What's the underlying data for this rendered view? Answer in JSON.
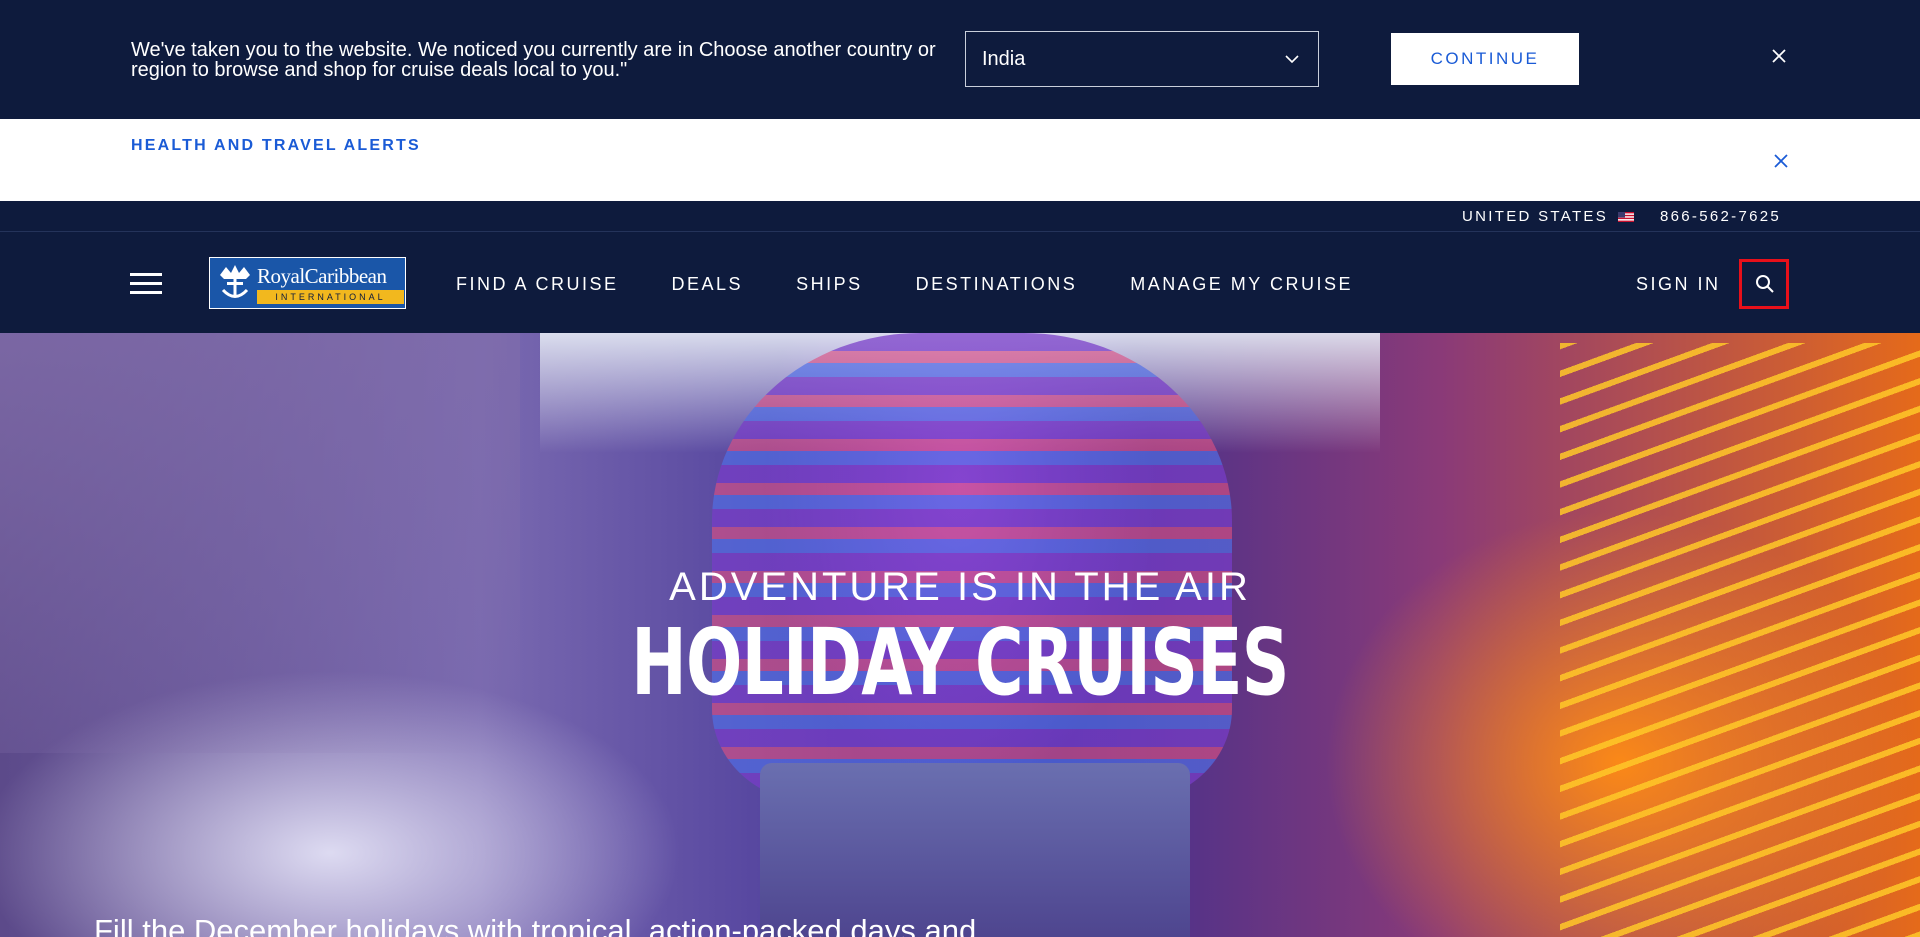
{
  "geo_banner": {
    "message": "We've taken you to the website. We noticed you currently are in Choose another country or region to browse and shop for cruise deals local to you.\"",
    "selected_country": "India",
    "continue_label": "CONTINUE"
  },
  "alert_bar": {
    "link_label": "HEALTH AND TRAVEL ALERTS"
  },
  "utility_bar": {
    "country_label": "UNITED STATES",
    "phone": "866-562-7625"
  },
  "logo": {
    "brand": "RoyalCaribbean",
    "tagline": "INTERNATIONAL"
  },
  "nav": {
    "items": [
      {
        "label": "FIND A CRUISE"
      },
      {
        "label": "DEALS"
      },
      {
        "label": "SHIPS"
      },
      {
        "label": "DESTINATIONS"
      },
      {
        "label": "MANAGE MY CRUISE"
      }
    ],
    "sign_in_label": "SIGN IN"
  },
  "hero": {
    "kicker": "ADVENTURE IS IN THE AIR",
    "title": "HOLIDAY CRUISES",
    "body": "Fill the December holidays with tropical, action-packed days and"
  },
  "colors": {
    "navy": "#0e1b3d",
    "accent_blue": "#1a5bd6",
    "highlight_red": "#e8101a",
    "logo_gold": "#f2b81e"
  }
}
